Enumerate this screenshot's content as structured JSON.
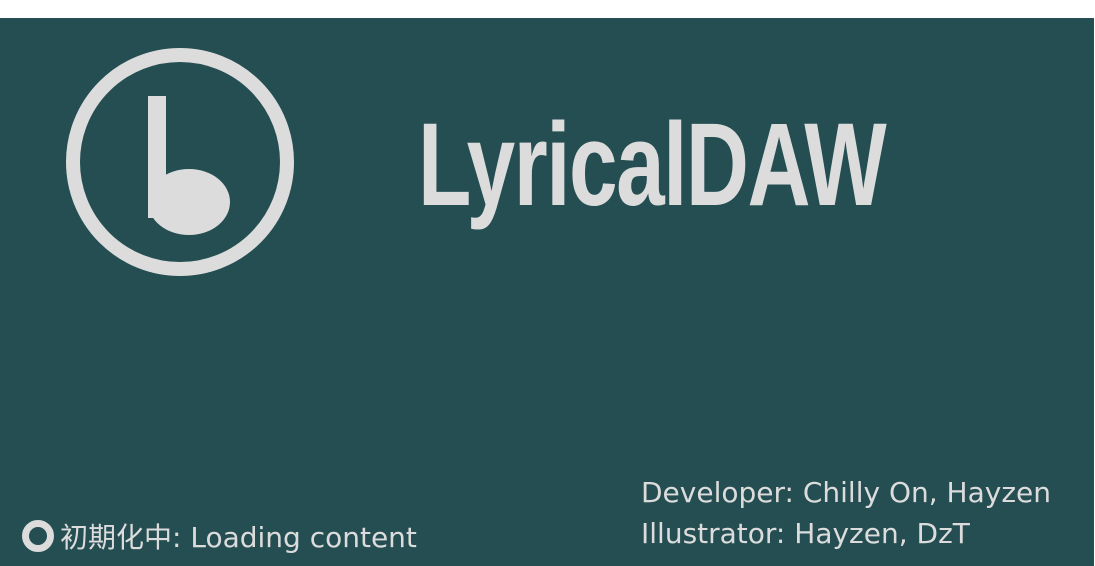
{
  "app": {
    "title": "LyricalDAW",
    "logo_icon": "music-note-icon"
  },
  "credits": {
    "developer": "Developer: Chilly On, Hayzen",
    "illustrator": "Illustrator: Hayzen, DzT"
  },
  "status": {
    "spinner_icon": "loading-ring-icon",
    "text": "初期化中: Loading content"
  },
  "colors": {
    "background": "#244e52",
    "foreground": "#dcdcdc",
    "page": "#ffffff"
  }
}
